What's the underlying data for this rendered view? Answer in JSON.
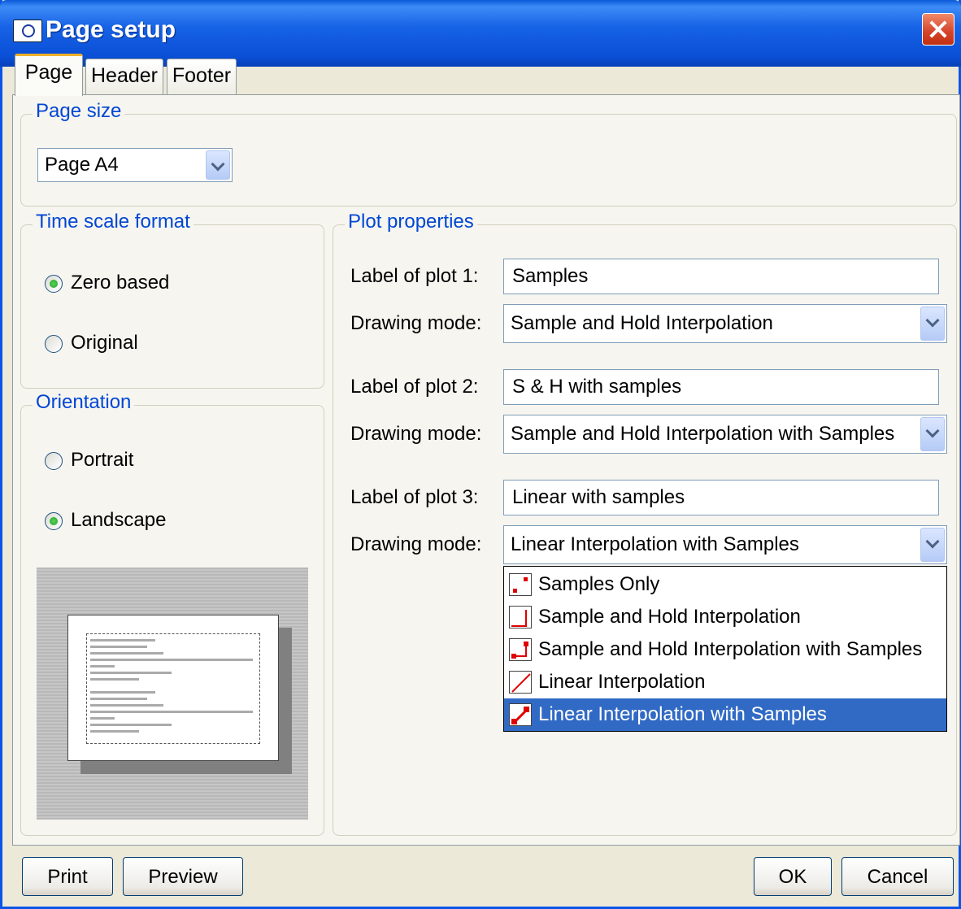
{
  "window": {
    "title": "Page setup"
  },
  "tabs": [
    {
      "label": "Page",
      "active": true
    },
    {
      "label": "Header",
      "active": false
    },
    {
      "label": "Footer",
      "active": false
    }
  ],
  "page_size": {
    "title": "Page size",
    "selected": "Page A4"
  },
  "time_scale": {
    "title": "Time scale format",
    "options": [
      {
        "label": "Zero based",
        "selected": true
      },
      {
        "label": "Original",
        "selected": false
      }
    ]
  },
  "orientation": {
    "title": "Orientation",
    "options": [
      {
        "label": "Portrait",
        "selected": false
      },
      {
        "label": "Landscape",
        "selected": true
      }
    ]
  },
  "plot_properties": {
    "title": "Plot properties",
    "plots": [
      {
        "label_caption": "Label of plot 1:",
        "label_value": "Samples",
        "mode_caption": "Drawing mode:",
        "mode_value": "Sample and Hold Interpolation"
      },
      {
        "label_caption": "Label of plot 2:",
        "label_value": "S & H with samples",
        "mode_caption": "Drawing mode:",
        "mode_value": "Sample and Hold Interpolation with Samples"
      },
      {
        "label_caption": "Label of plot 3:",
        "label_value": "Linear with samples",
        "mode_caption": "Drawing mode:",
        "mode_value": "Linear Interpolation with Samples"
      }
    ]
  },
  "drawing_mode_options": [
    {
      "label": "Samples Only",
      "icon": "samples-only-icon",
      "selected": false
    },
    {
      "label": "Sample and Hold Interpolation",
      "icon": "sample-hold-icon",
      "selected": false
    },
    {
      "label": "Sample and Hold Interpolation with Samples",
      "icon": "sample-hold-samples-icon",
      "selected": false
    },
    {
      "label": "Linear Interpolation",
      "icon": "linear-icon",
      "selected": false
    },
    {
      "label": "Linear Interpolation with Samples",
      "icon": "linear-samples-icon",
      "selected": true
    }
  ],
  "buttons": {
    "print": "Print",
    "preview": "Preview",
    "ok": "OK",
    "cancel": "Cancel"
  },
  "colors": {
    "titlebar": "#0a54e8",
    "group_title": "#0046d5",
    "selection": "#316ac5",
    "icon_red": "#e00000"
  }
}
